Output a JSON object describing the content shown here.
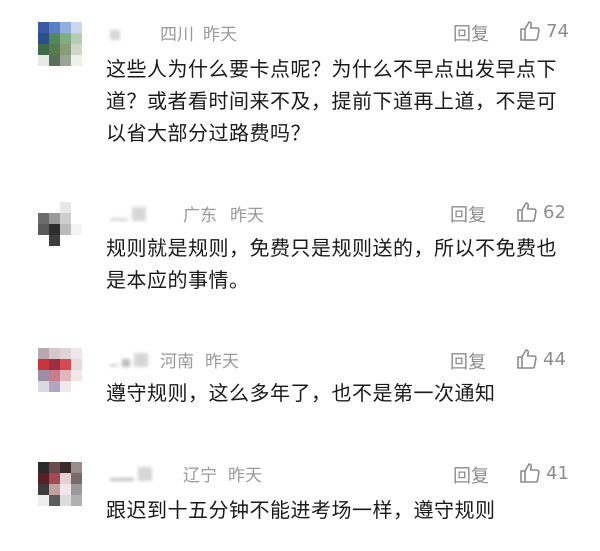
{
  "comments": [
    {
      "region": "四川",
      "time": "昨天",
      "reply_label": "回复",
      "like_icon": "thumbs-up-icon",
      "likes": "74",
      "text": "这些人为什么要卡点呢？为什么不早点出发早点下道？或者看时间来不及，提前下道再上道，不是可以省大部分过路费吗？"
    },
    {
      "region": "广东",
      "time": "昨天",
      "reply_label": "回复",
      "like_icon": "thumbs-up-icon",
      "likes": "62",
      "text": "规则就是规则，免费只是规则送的，所以不免费也是本应的事情。"
    },
    {
      "region": "河南",
      "time": "昨天",
      "reply_label": "回复",
      "like_icon": "thumbs-up-icon",
      "likes": "44",
      "text": "遵守规则，这么多年了，也不是第一次通知"
    },
    {
      "region": "辽宁",
      "time": "昨天",
      "reply_label": "回复",
      "like_icon": "thumbs-up-icon",
      "likes": "41",
      "text": "跟迟到十五分钟不能进考场一样，遵守规则"
    }
  ],
  "colors": {
    "text": "#1a1a1a",
    "meta": "#9a9a9a",
    "action": "#8c8c8c"
  }
}
